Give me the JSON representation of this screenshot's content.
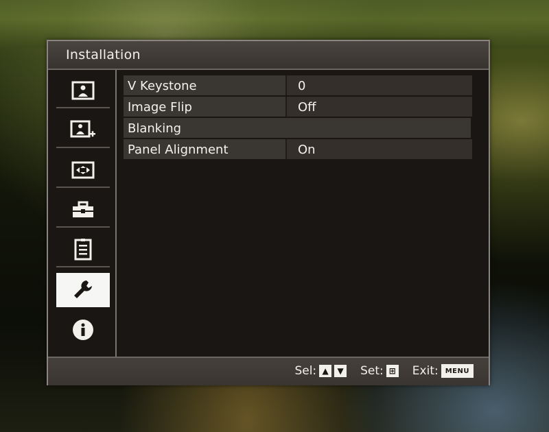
{
  "window": {
    "title": "Installation"
  },
  "sidebar": {
    "items": [
      {
        "icon": "picture-icon",
        "active": false
      },
      {
        "icon": "picture-plus-icon",
        "active": false
      },
      {
        "icon": "screen-fit-icon",
        "active": false
      },
      {
        "icon": "toolbox-icon",
        "active": false
      },
      {
        "icon": "checklist-icon",
        "active": false
      },
      {
        "icon": "wrench-icon",
        "active": true
      },
      {
        "icon": "info-icon",
        "active": false
      }
    ]
  },
  "settings": [
    {
      "label": "V Keystone",
      "value": "0"
    },
    {
      "label": "Image Flip",
      "value": "Off"
    },
    {
      "label": "Blanking",
      "value": ""
    },
    {
      "label": "Panel Alignment",
      "value": "On"
    }
  ],
  "footer": {
    "sel_label": "Sel:",
    "sel_up_key": "▲",
    "sel_down_key": "▼",
    "set_label": "Set:",
    "set_key": "⊞",
    "exit_label": "Exit:",
    "exit_key": "MENU"
  },
  "colors": {
    "panel_bg": "#1a1613",
    "row_bg": "#3a3632",
    "active_item_bg": "#f6f6f4",
    "text": "#f4f2ec"
  }
}
